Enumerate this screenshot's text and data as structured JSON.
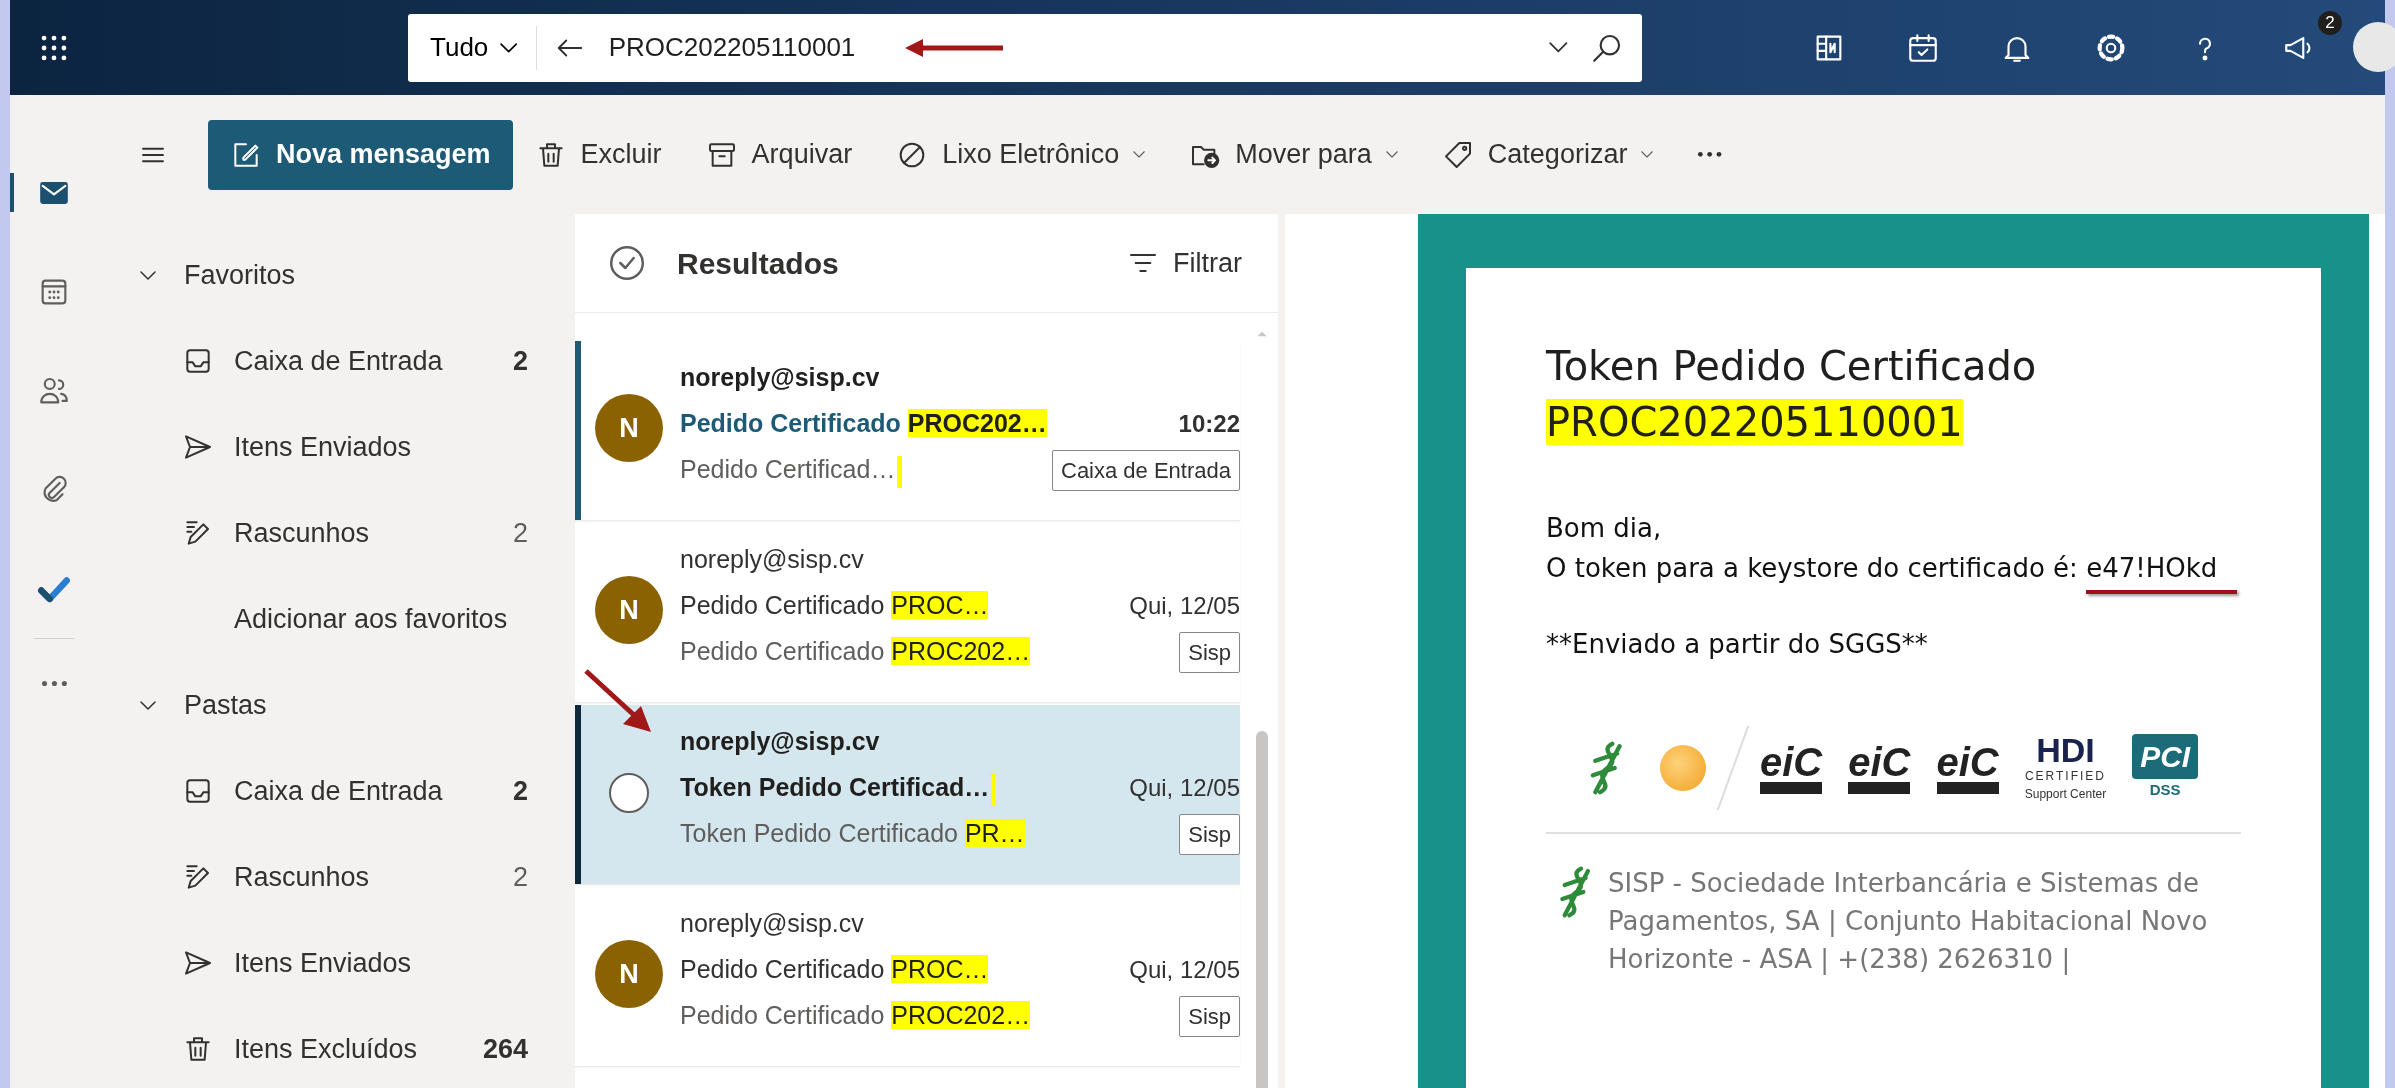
{
  "app_bar": {
    "search": {
      "scope": "Tudo",
      "value": "PROC202205110001"
    },
    "notification_count": "2"
  },
  "rail": [
    {
      "kind": "mail",
      "selected": true
    },
    {
      "kind": "calendar",
      "selected": false
    },
    {
      "kind": "people",
      "selected": false
    },
    {
      "kind": "attachment",
      "selected": false
    },
    {
      "kind": "todo",
      "selected": false
    },
    {
      "kind": "more",
      "selected": false
    }
  ],
  "toolbar": {
    "new_message": "Nova mensagem",
    "actions": [
      {
        "label": "Excluir",
        "kind": "trash",
        "dropdown": false
      },
      {
        "label": "Arquivar",
        "kind": "archive",
        "dropdown": false
      },
      {
        "label": "Lixo Eletrônico",
        "kind": "block",
        "dropdown": true
      },
      {
        "label": "Mover para",
        "kind": "move",
        "dropdown": true
      },
      {
        "label": "Categorizar",
        "kind": "tag",
        "dropdown": true
      }
    ]
  },
  "folders": [
    {
      "title": "Favoritos",
      "expanded": true,
      "items": [
        {
          "label": "Caixa de Entrada",
          "kind": "inbox",
          "count": "2",
          "unread": true
        },
        {
          "label": "Itens Enviados",
          "kind": "send"
        },
        {
          "label": "Rascunhos",
          "kind": "draft",
          "count": "2",
          "unread": false
        }
      ],
      "add_link": "Adicionar aos favoritos"
    },
    {
      "title": "Pastas",
      "expanded": true,
      "items": [
        {
          "label": "Caixa de Entrada",
          "kind": "inbox",
          "count": "2",
          "unread": true
        },
        {
          "label": "Rascunhos",
          "kind": "draft",
          "count": "2",
          "unread": false
        },
        {
          "label": "Itens Enviados",
          "kind": "send"
        },
        {
          "label": "Itens Excluídos",
          "kind": "trash",
          "count": "264",
          "unread": true
        }
      ]
    }
  ],
  "message_list": {
    "title": "Resultados",
    "filter": "Filtrar",
    "messages": [
      {
        "avatar": "N",
        "sender": "noreply@sisp.cv",
        "subject": {
          "parts": [
            {
              "text": "Pedido Certificado ",
              "highlighted": false
            },
            {
              "text": "PROC202…",
              "highlighted": true
            }
          ]
        },
        "time": "10:22",
        "preview": {
          "parts": [
            {
              "text": "Pedido Certificad…",
              "highlighted": false
            }
          ],
          "trailing_mark": true
        },
        "tag": "Caixa de Entrada",
        "unread": true,
        "selected": false
      },
      {
        "avatar": "N",
        "sender": "noreply@sisp.cv",
        "subject": {
          "parts": [
            {
              "text": "Pedido Certificado ",
              "highlighted": false
            },
            {
              "text": "PROC…",
              "highlighted": true
            }
          ]
        },
        "time": "Qui, 12/05",
        "preview": {
          "parts": [
            {
              "text": "Pedido Certificado ",
              "highlighted": false
            },
            {
              "text": "PROC202…",
              "highlighted": true
            }
          ]
        },
        "tag": "Sisp",
        "unread": false,
        "selected": false
      },
      {
        "sender": "noreply@sisp.cv",
        "subject": {
          "parts": [
            {
              "text": "Token Pedido Certificad…",
              "highlighted": false
            }
          ],
          "trailing_mark": true
        },
        "time": "Qui, 12/05",
        "preview": {
          "parts": [
            {
              "text": "Token Pedido Certificado ",
              "highlighted": false
            },
            {
              "text": "PR…",
              "highlighted": true
            }
          ]
        },
        "tag": "Sisp",
        "unread": true,
        "selected": true
      },
      {
        "avatar": "N",
        "sender": "noreply@sisp.cv",
        "subject": {
          "parts": [
            {
              "text": "Pedido Certificado ",
              "highlighted": false
            },
            {
              "text": "PROC…",
              "highlighted": true
            }
          ]
        },
        "time": "Qui, 12/05",
        "preview": {
          "parts": [
            {
              "text": "Pedido Certificado ",
              "highlighted": false
            },
            {
              "text": "PROC202…",
              "highlighted": true
            }
          ]
        },
        "tag": "Sisp",
        "unread": false,
        "selected": false
      }
    ]
  },
  "email": {
    "title": "Token Pedido Certificado",
    "title_highlight": "PROC202205110001",
    "greeting": "Bom dia,",
    "token_line": "O token para a keystore do certificado é:",
    "token": "e47!HOkd",
    "signature": "**Enviado a partir do SGGS**",
    "logos": [
      {
        "kind": "sisp"
      },
      {
        "kind": "round"
      },
      {
        "kind": "eic",
        "text": "eiC"
      },
      {
        "kind": "eic",
        "text": "eiC"
      },
      {
        "kind": "eic",
        "text": "eiC"
      },
      {
        "kind": "hdi",
        "text": "HDI",
        "sub": "CERTIFIED",
        "caption": "Support Center"
      },
      {
        "kind": "pci",
        "text": "PCI",
        "sub": "DSS"
      }
    ],
    "footer": "SISP - Sociedade Interbancária e Sistemas de Pagamentos, SA | Conjunto Habitacional Novo Horizonte - ASA | +(238) 2626310 |"
  }
}
